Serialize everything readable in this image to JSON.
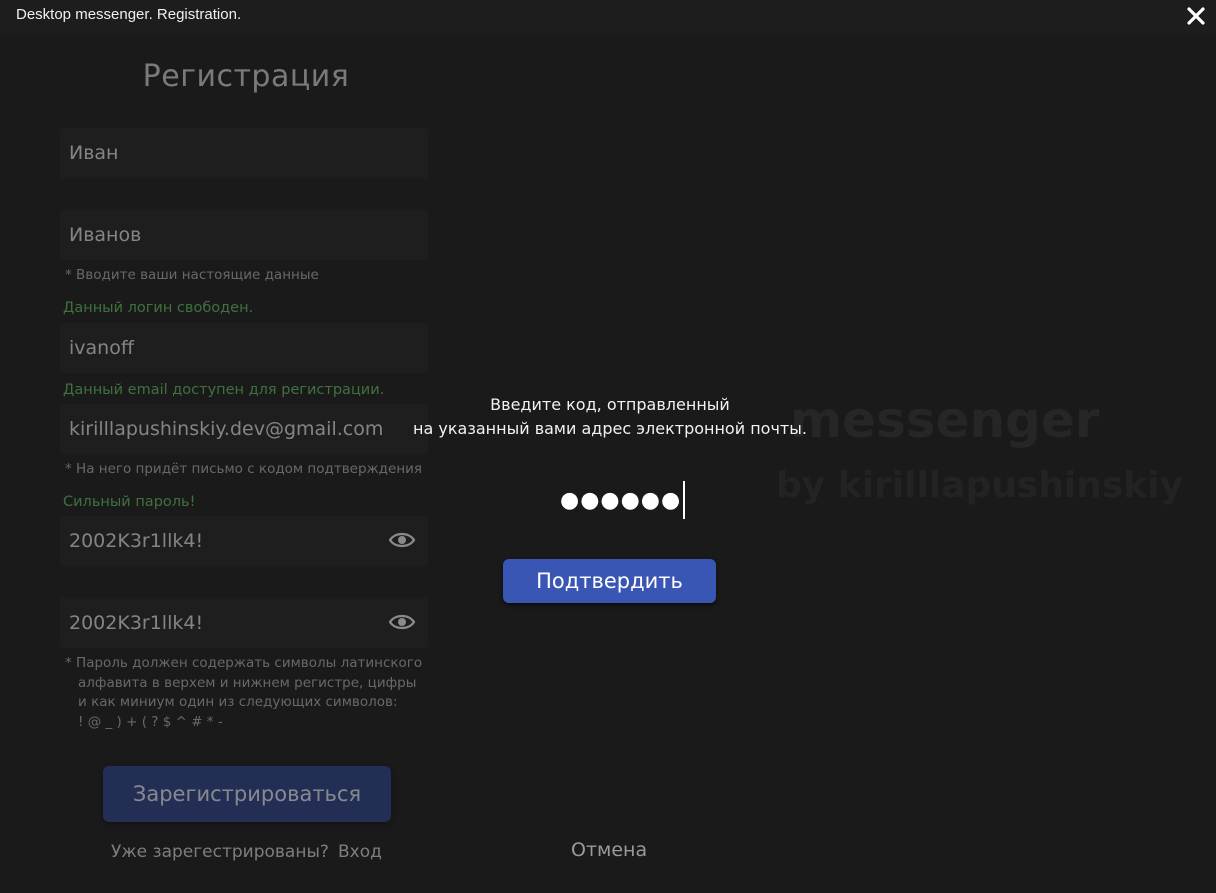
{
  "window": {
    "title": "Desktop messenger. Registration."
  },
  "registration": {
    "heading": "Регистрация",
    "first_name": "Иван",
    "last_name": "Иванов",
    "real_data_hint": "* Вводите ваши настоящие данные",
    "login_status": "Данный логин свободен.",
    "login": "ivanoff",
    "email_status": "Данный email доступен для регистрации.",
    "email": "kirilllapushinskiy.dev@gmail.com",
    "email_hint": "* На него придёт письмо с кодом подтверждения",
    "password_status": "Сильный пароль!",
    "password": "2002K3r1llk4!",
    "password_confirm": "2002K3r1llk4!",
    "password_rules": [
      "* Пароль должен содержать символы латинского",
      "алфавита в верхем и нижнем регистре, цифры",
      "и как миниум один из следующих символов:",
      "! @ _ ) + ( ? $ ^ # * -"
    ],
    "register_button": "Зарегистрироваться",
    "already_registered": "Уже зарегестрированы?",
    "login_link": "Вход"
  },
  "watermark": {
    "line1": "messenger",
    "line2": "by kirilllapushinskiy"
  },
  "verification": {
    "prompt_line1": "Введите код, отправленный",
    "prompt_line2": "на указанный вами адрес электронной почты.",
    "code_masked": "●●●●●●",
    "confirm_button": "Подтвердить",
    "cancel": "Отмена"
  },
  "colors": {
    "background": "#1a1a1a",
    "accent_button": "#3a56b4",
    "success_text": "#5cb85c"
  },
  "icons": [
    "close-icon",
    "eye-icon"
  ]
}
